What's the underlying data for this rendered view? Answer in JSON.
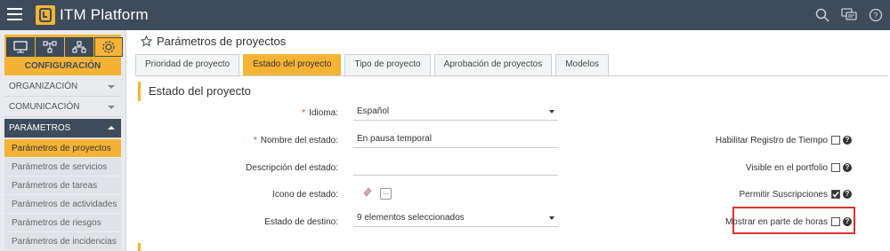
{
  "app": {
    "brand": "ITM Platform"
  },
  "top_icons": [
    "search-icon",
    "chat-icon",
    "help-icon"
  ],
  "sidebar": {
    "config_label": "CONFIGURACIÓN",
    "config_icons": [
      "monitor-icon",
      "hierarchy-icon",
      "org-chart-icon",
      "gear-icon"
    ],
    "sections": [
      {
        "label": "ORGANIZACIÓN"
      },
      {
        "label": "COMUNICACIÓN"
      },
      {
        "label": "PARÁMETROS"
      }
    ],
    "items": [
      {
        "label": "Parámetros de proyectos"
      },
      {
        "label": "Parámetros de servicios"
      },
      {
        "label": "Parámetros de tareas"
      },
      {
        "label": "Parámetros de actividades"
      },
      {
        "label": "Parámetros de riesgos"
      },
      {
        "label": "Parámetros de incidencias"
      }
    ]
  },
  "main": {
    "title": "Parámetros de proyectos",
    "tabs": [
      {
        "label": "Prioridad de proyecto"
      },
      {
        "label": "Estado del proyecto"
      },
      {
        "label": "Tipo de proyecto"
      },
      {
        "label": "Aprobación de proyectos"
      },
      {
        "label": "Modelos"
      }
    ],
    "section_title": "Estado del proyecto",
    "form": {
      "idioma_label": "Idioma:",
      "idioma_value": "Español",
      "nombre_label": "Nombre del estado:",
      "nombre_value": "En pausa temporal",
      "descripcion_label": "Descripción del estado:",
      "descripcion_value": "",
      "icono_label": "Icono de estado:",
      "icono_button": "...",
      "destino_label": "Estado de destino:",
      "destino_value": "9 elementos seleccionados"
    },
    "options": {
      "registro_tiempo": {
        "label": "Habilitar Registro de Tiempo",
        "checked": false
      },
      "visible_portfolio": {
        "label": "Visible en el portfolio",
        "checked": false
      },
      "permitir_suscripciones": {
        "label": "Permitir Suscripciones",
        "checked": true
      },
      "mostrar_parte_horas": {
        "label": "Mostrar en parte de horas",
        "checked": false
      }
    }
  },
  "colors": {
    "topbar": "#3d4b5b",
    "accent": "#f5b335",
    "highlight": "#d9342b"
  }
}
